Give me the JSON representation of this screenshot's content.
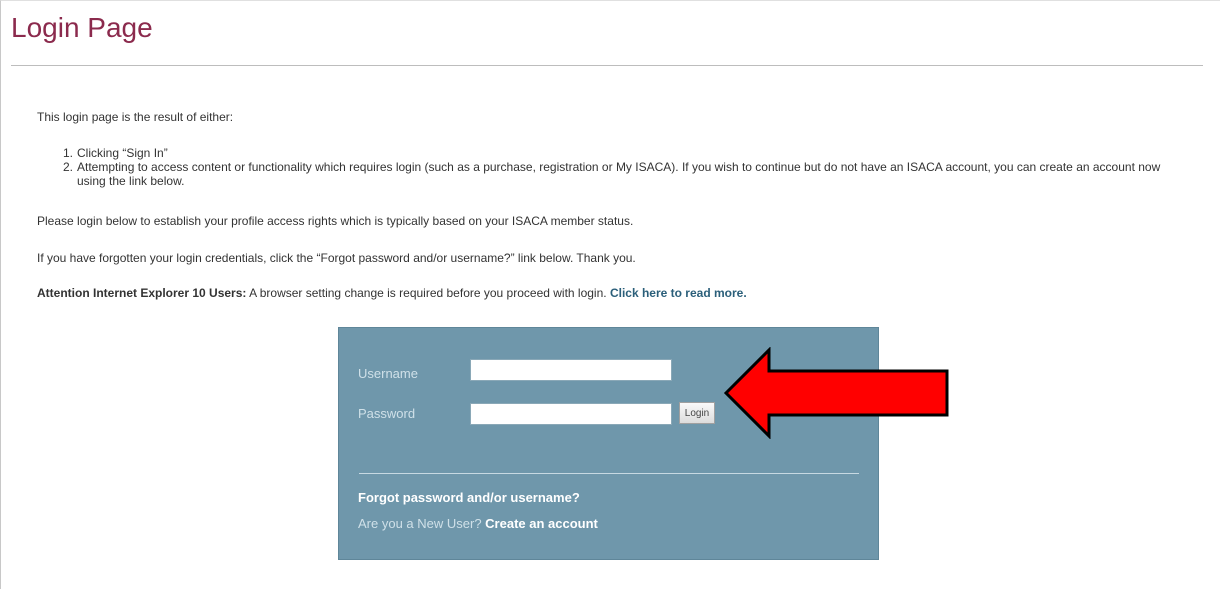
{
  "page": {
    "title": "Login Page"
  },
  "content": {
    "intro": "This login page is the result of either:",
    "steps": [
      {
        "num": "1.",
        "text": "Clicking “Sign In”"
      },
      {
        "num": "2.",
        "text": "Attempting to access content or functionality which requires login (such as a purchase, registration or My ISACA). If you wish to continue but do not have an ISACA account, you can create an account now using the link below."
      }
    ],
    "para_login": "Please login below to establish your profile access rights which is typically based on your ISACA member status.",
    "para_forgot": "If you have forgotten your login credentials, click the “Forgot password and/or username?” link below. Thank you.",
    "attention_label": "Attention Internet Explorer 10 Users:",
    "attention_text": " A browser setting change is required before you proceed with login. ",
    "attention_link": "Click here to read more."
  },
  "login_form": {
    "username_label": "Username",
    "username_value": "",
    "password_label": "Password",
    "password_value": "",
    "login_button": "Login",
    "forgot_link": "Forgot password and/or username?",
    "new_user_prompt": "Are you a New User? ",
    "create_account_link": "Create an account"
  },
  "colors": {
    "title": "#8b2a4d",
    "login_box_bg": "#6f97ab",
    "annotation_arrow": "#ff0000"
  },
  "annotation": {
    "icon": "red-arrow-icon",
    "points_to": "login-button"
  }
}
